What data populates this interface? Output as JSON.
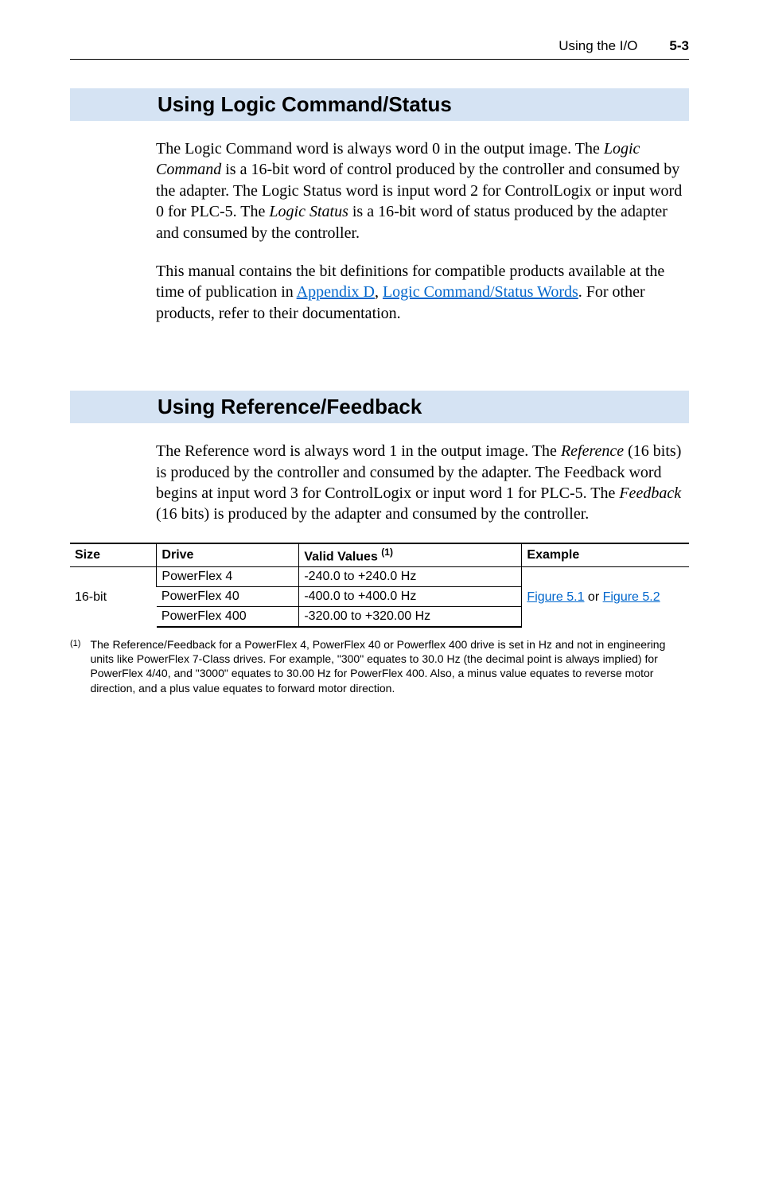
{
  "header": {
    "title": "Using the I/O",
    "page": "5-3"
  },
  "section1": {
    "heading": "Using Logic Command/Status",
    "para1_a": "The Logic Command word is always word 0 in the output image. The ",
    "para1_b": "Logic Command",
    "para1_c": " is a 16-bit word of control produced by the controller and consumed by the adapter. The Logic Status word is input word 2 for ControlLogix or input word 0 for PLC-5. The ",
    "para1_d": "Logic Status",
    "para1_e": " is a 16-bit word of status produced by the adapter and consumed by the controller.",
    "para2_a": "This manual contains the bit definitions for compatible products available at the time of publication in ",
    "para2_link1": "Appendix D",
    "para2_b": ", ",
    "para2_link2": "Logic Command/Status Words",
    "para2_c": ". For other products, refer to their documentation."
  },
  "section2": {
    "heading": "Using Reference/Feedback",
    "para1_a": "The Reference word is always word 1 in the output image. The ",
    "para1_b": "Reference",
    "para1_c": " (16 bits) is produced by the controller and consumed by the adapter. The Feedback word begins at input word 3 for ControlLogix or input word 1 for PLC-5. The ",
    "para1_d": "Feedback",
    "para1_e": " (16 bits) is produced by the adapter and consumed by the controller."
  },
  "table": {
    "headers": {
      "size": "Size",
      "drive": "Drive",
      "valid": "Valid Values ",
      "valid_sup": "(1)",
      "example": "Example"
    },
    "size_val": "16-bit",
    "rows": [
      {
        "drive": "PowerFlex 4",
        "valid": "-240.0 to +240.0 Hz"
      },
      {
        "drive": "PowerFlex 40",
        "valid": "-400.0 to +400.0 Hz"
      },
      {
        "drive": "PowerFlex 400",
        "valid": "-320.00 to +320.00 Hz"
      }
    ],
    "example_link1": "Figure 5.1",
    "example_mid": " or ",
    "example_link2": "Figure 5.2"
  },
  "footnote": {
    "marker": "(1)",
    "text": "The Reference/Feedback for a PowerFlex 4, PowerFlex 40 or Powerflex 400 drive is set in Hz and not in engineering units like PowerFlex 7-Class drives. For example, \"300\" equates to 30.0 Hz (the decimal point is always implied) for PowerFlex 4/40, and \"3000\" equates to 30.00 Hz for PowerFlex 400. Also, a minus value equates to reverse motor direction, and a plus value equates to forward motor direction."
  }
}
